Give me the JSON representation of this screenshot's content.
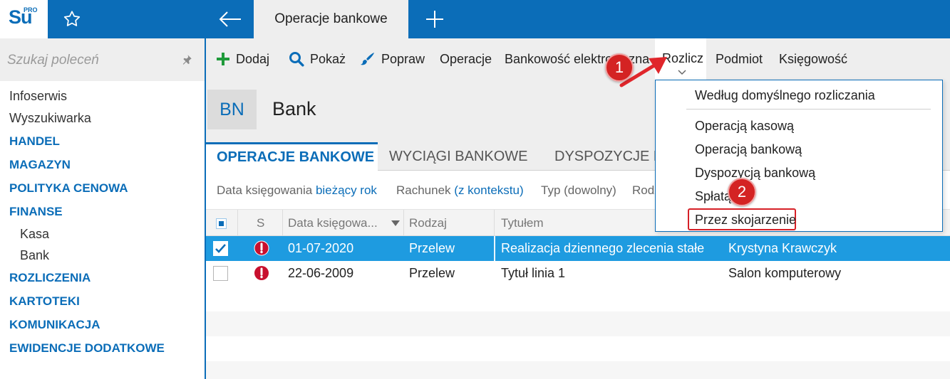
{
  "app": {
    "logo_text": "Su",
    "logo_superscript": "PRO",
    "active_tab": "Operacje bankowe"
  },
  "sidebar": {
    "search_placeholder": "Szukaj poleceń",
    "items": [
      {
        "label": "Infoserwis",
        "type": "plain"
      },
      {
        "label": "Wyszukiwarka",
        "type": "plain"
      },
      {
        "label": "HANDEL",
        "type": "section"
      },
      {
        "label": "MAGAZYN",
        "type": "section"
      },
      {
        "label": "POLITYKA CENOWA",
        "type": "section"
      },
      {
        "label": "FINANSE",
        "type": "section"
      },
      {
        "label": "Kasa",
        "type": "sub"
      },
      {
        "label": "Bank",
        "type": "sub"
      },
      {
        "label": "ROZLICZENIA",
        "type": "section"
      },
      {
        "label": "KARTOTEKI",
        "type": "section"
      },
      {
        "label": "KOMUNIKACJA",
        "type": "section"
      },
      {
        "label": "EWIDENCJE DODATKOWE",
        "type": "section"
      }
    ]
  },
  "toolbar": {
    "add": "Dodaj",
    "show": "Pokaż",
    "edit": "Popraw",
    "operations": "Operacje",
    "ebanking": "Bankowość elektroniczna",
    "settle": "Rozlicz",
    "entity": "Podmiot",
    "accounting": "Księgowość"
  },
  "header": {
    "badge": "BN",
    "title": "Bank"
  },
  "tabs": [
    {
      "label": "OPERACJE BANKOWE",
      "active": true
    },
    {
      "label": "WYCIĄGI BANKOWE",
      "active": false
    },
    {
      "label": "DYSPOZYCJE BA",
      "active": false
    }
  ],
  "filters": {
    "date_label": "Data księgowania",
    "date_value": "bieżący rok",
    "account_label": "Rachunek",
    "account_value": "(z kontekstu)",
    "type_label": "Typ (dowolny)",
    "kind_label": "Rodz"
  },
  "grid": {
    "columns": {
      "status": "S",
      "date": "Data księgowa...",
      "kind": "Rodzaj",
      "title": "Tytułem"
    },
    "rows": [
      {
        "checked": true,
        "selected": true,
        "date": "01-07-2020",
        "kind": "Przelew",
        "title": "Realizacja dziennego zlecenia stałe",
        "party": "Krystyna Krawczyk"
      },
      {
        "checked": false,
        "selected": false,
        "date": "22-06-2009",
        "kind": "Przelew",
        "title": "Tytuł linia 1",
        "party": "Salon komputerowy"
      }
    ]
  },
  "dropdown": {
    "items": [
      "Według domyślnego rozliczania",
      "Operacją kasową",
      "Operacją bankową",
      "Dyspozycją bankową",
      "Spłatą",
      "Przez skojarzenie"
    ]
  },
  "callouts": {
    "step1": "1",
    "step2": "2"
  },
  "colors": {
    "brand_blue": "#0b6db8",
    "selected_row": "#1e9be0",
    "callout_red": "#d42323",
    "add_green": "#1f9a3a"
  },
  "icons": {
    "favorite": "star-icon",
    "back": "arrow-left-icon",
    "new_tab": "plus-icon",
    "pin": "pin-icon",
    "add": "plus-icon",
    "show": "search-icon",
    "edit": "brush-icon",
    "status": "exclamation-icon",
    "sort": "sort-down-icon"
  }
}
